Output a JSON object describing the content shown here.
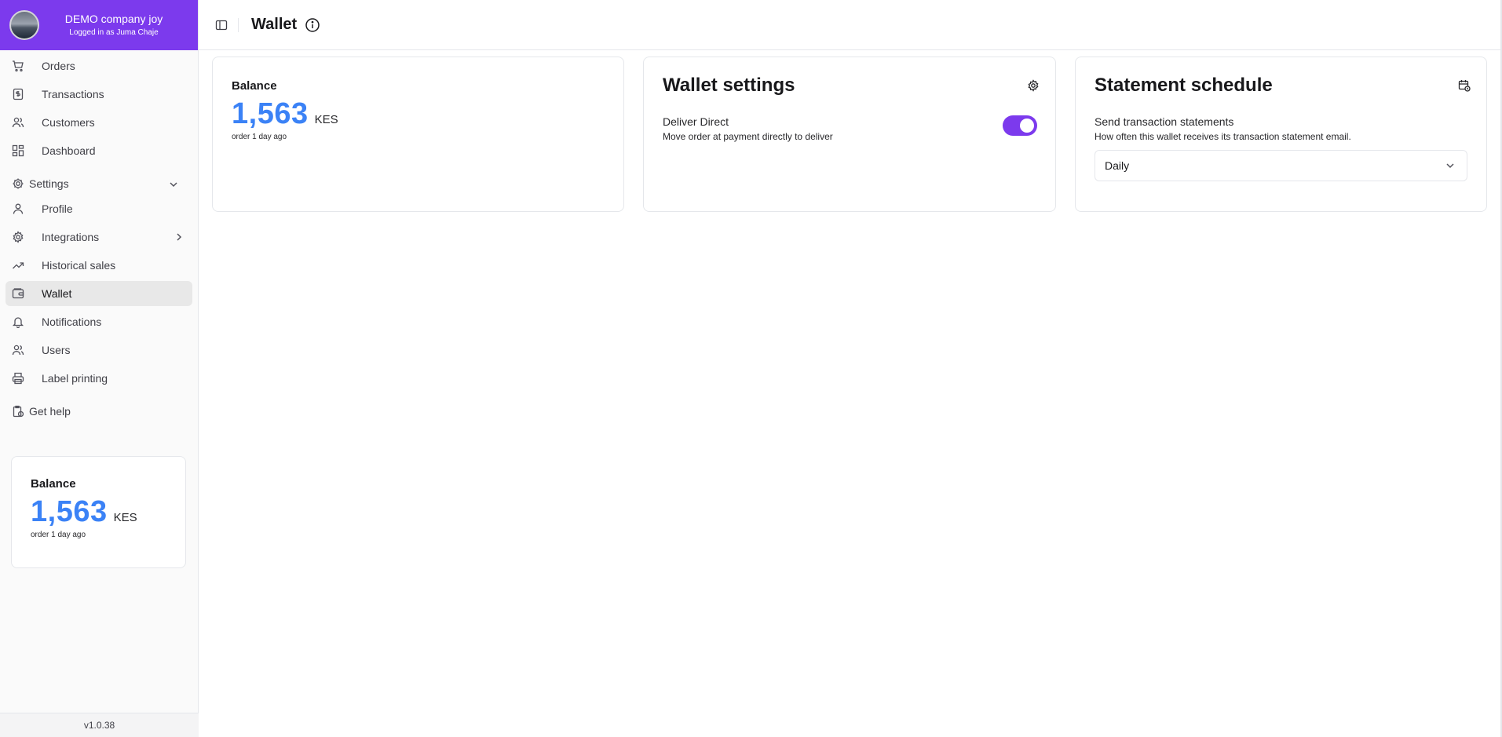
{
  "account": {
    "company": "DEMO company joy",
    "logged_in": "Logged in as Juma Chaje"
  },
  "nav": [
    {
      "label": "Orders",
      "icon": "cart-icon"
    },
    {
      "label": "Transactions",
      "icon": "receipt-icon"
    },
    {
      "label": "Customers",
      "icon": "users-icon"
    },
    {
      "label": "Dashboard",
      "icon": "dashboard-icon"
    }
  ],
  "settings_section": {
    "label": "Settings",
    "icon": "cog-icon"
  },
  "settings_items": [
    {
      "label": "Profile",
      "icon": "user-icon"
    },
    {
      "label": "Integrations",
      "icon": "gear-icon"
    },
    {
      "label": "Historical sales",
      "icon": "trend-icon"
    },
    {
      "label": "Wallet",
      "icon": "wallet-icon",
      "active": true
    },
    {
      "label": "Notifications",
      "icon": "bell-icon"
    },
    {
      "label": "Users",
      "icon": "users-icon"
    },
    {
      "label": "Label printing",
      "icon": "printer-icon"
    }
  ],
  "help": {
    "label": "Get help",
    "icon": "help-icon"
  },
  "sidebar_balance": {
    "label": "Balance",
    "amount": "1,563",
    "currency": "KES",
    "note": "order 1 day ago"
  },
  "version": "v1.0.38",
  "header": {
    "title": "Wallet"
  },
  "balance_card": {
    "label": "Balance",
    "amount": "1,563",
    "currency": "KES",
    "note": "order 1 day ago"
  },
  "wallet_settings": {
    "title": "Wallet settings",
    "deliver_direct_label": "Deliver Direct",
    "deliver_direct_desc": "Move order at payment directly to deliver",
    "deliver_direct_enabled": true
  },
  "statement_schedule": {
    "title": "Statement schedule",
    "field_label": "Send transaction statements",
    "field_desc": "How often this wallet receives its transaction statement email.",
    "selected": "Daily"
  },
  "colors": {
    "accent": "#7c3aed",
    "balance": "#3b82f6"
  }
}
